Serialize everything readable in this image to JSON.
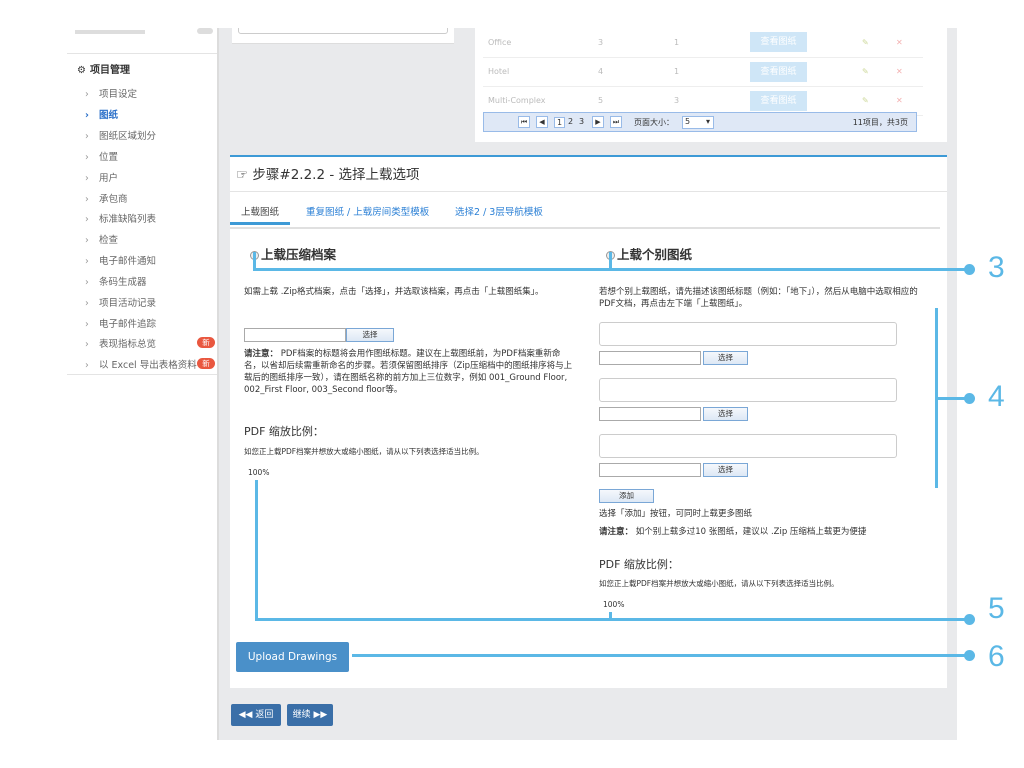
{
  "sidebar": {
    "section_title": "项目管理",
    "items": [
      {
        "label": "项目设定",
        "active": false
      },
      {
        "label": "图纸",
        "active": true
      },
      {
        "label": "图纸区域划分",
        "active": false
      },
      {
        "label": "位置",
        "active": false
      },
      {
        "label": "用户",
        "active": false
      },
      {
        "label": "承包商",
        "active": false
      },
      {
        "label": "标准缺陷列表",
        "active": false
      },
      {
        "label": "检查",
        "active": false
      },
      {
        "label": "电子邮件通知",
        "active": false
      },
      {
        "label": "条码生成器",
        "active": false
      },
      {
        "label": "项目活动记录",
        "active": false
      },
      {
        "label": "电子邮件追踪",
        "active": false
      },
      {
        "label": "表现指标总览",
        "active": false,
        "badge": "新"
      },
      {
        "label": "以 Excel 导出表格资料",
        "active": false,
        "badge": "新"
      }
    ]
  },
  "grid": {
    "rows": [
      {
        "name": "Office",
        "c1": "3",
        "c2": "1",
        "button": "查看图纸"
      },
      {
        "name": "Hotel",
        "c1": "4",
        "c2": "1",
        "button": "查看图纸"
      },
      {
        "name": "Multi-Complex",
        "c1": "5",
        "c2": "3",
        "button": "查看图纸"
      }
    ],
    "pager": {
      "pages": [
        "1",
        "2",
        "3"
      ],
      "page_size_label": "页面大小：",
      "page_size": "5",
      "info": "11项目，共3页"
    }
  },
  "step": {
    "title": "步骤#2.2.2 - 选择上载选项",
    "tabs": [
      "上载图纸",
      "重复图纸 / 上载房间类型模板",
      "选择2 / 3层导航模板"
    ],
    "left": {
      "radio_label": "上载压缩档案",
      "desc": "如需上载 .Zip格式档案，点击「选择」，并选取该档案，再点击「上载图纸集」。",
      "choose": "选择",
      "note_label": "请注意：",
      "note": "PDF档案的标题将会用作图纸标题。建议在上载图纸前，为PDF档案重新命名，以省却后续需重新命名的步骤。若须保留图纸排序（Zip压缩档中的图纸排序将与上载后的图纸排序一致），请在图纸名称的前方加上三位数字，例如 001_Ground Floor, 002_First Floor, 003_Second floor等。",
      "pdf_title": "PDF 缩放比例：",
      "pdf_desc": "如您正上载PDF档案并想放大或缩小图纸，请从以下列表选择适当比例。",
      "scale": "100%"
    },
    "right": {
      "radio_label": "上载个别图纸",
      "desc": "若想个别上载图纸，请先描述该图纸标题（例如：「地下」），然后从电脑中选取相应的PDF文档，再点击左下端「上载图纸」。",
      "choose": "选择",
      "add": "添加",
      "add_hint": "选择「添加」按钮，可同时上载更多图纸",
      "note_label": "请注意：",
      "note": "如个别上载多过10 张图纸，建议以 .Zip 压缩档上载更为便捷",
      "pdf_title": "PDF 缩放比例：",
      "pdf_desc": "如您正上载PDF档案并想放大或缩小图纸，请从以下列表选择适当比例。",
      "scale": "100%"
    },
    "upload_button": "Upload Drawings"
  },
  "nav": {
    "back": "返回",
    "next": "继续"
  },
  "annotations": [
    "3",
    "4",
    "5",
    "6"
  ]
}
